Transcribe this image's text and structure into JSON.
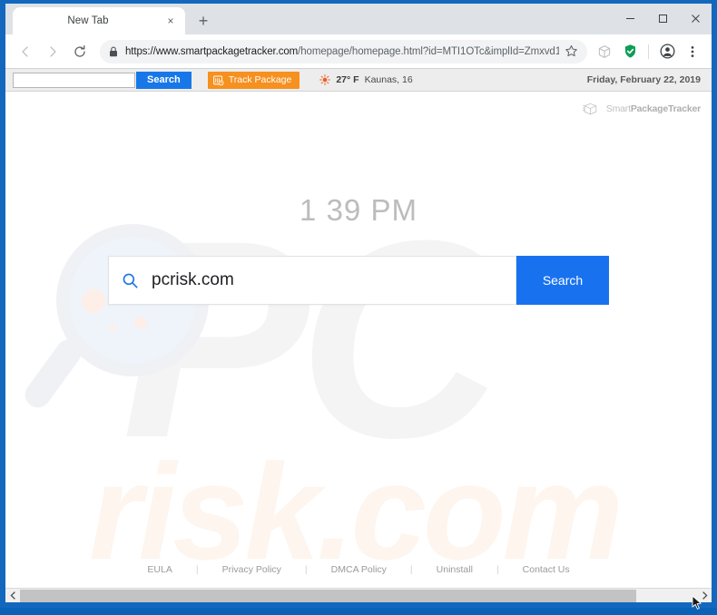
{
  "browser": {
    "tab": {
      "title": "New Tab",
      "close_label": "×"
    },
    "newtab_label": "+",
    "window_controls": {
      "minimize": "minimize",
      "maximize": "maximize",
      "close": "close"
    },
    "nav": {
      "back": "back",
      "forward": "forward",
      "reload": "reload"
    },
    "url": {
      "scheme_host": "https://www.smartpackagetracker.com",
      "path": "/homepage/homepage.html?id=MTI1OTc&implId=Zmxvd1...",
      "full": "https://www.smartpackagetracker.com/homepage/homepage.html?id=MTI1OTc&implId=Zmxvd1...",
      "secure_icon": "lock-icon"
    },
    "toolbar_icons": [
      "star-icon",
      "package-extension-icon",
      "shield-check-icon",
      "profile-avatar-icon",
      "three-dot-menu-icon"
    ]
  },
  "ext_toolbar": {
    "search_placeholder": "",
    "search_value": "",
    "search_button": "Search",
    "track_button": "Track Package",
    "weather": {
      "icon": "sun-icon",
      "temperature": "27° F",
      "location": "Kaunas, 16"
    },
    "date": "Friday, February 22, 2019"
  },
  "page": {
    "logo": {
      "prefix": "Smart",
      "bold": "PackageTracker",
      "icon": "package-box-icon"
    },
    "clock": {
      "hours": "1",
      "colon": ":",
      "minutes": "39",
      "meridiem": "PM"
    },
    "search": {
      "value": "pcrisk.com",
      "placeholder": "",
      "button_label": "Search",
      "icon": "search-magnifier-icon"
    },
    "watermarks": {
      "big": "PC",
      "small": "risk.com"
    },
    "footer_links": [
      "EULA",
      "Privacy Policy",
      "DMCA Policy",
      "Uninstall",
      "Contact Us"
    ],
    "footer_separator": "|"
  },
  "colors": {
    "window_frame": "#1368be",
    "accent_blue": "#1872f0",
    "track_orange": "#f6901e",
    "shield_green": "#0f9d58",
    "watermark_pc": "#f4f4f4",
    "watermark_risk": "#fdf5ee"
  }
}
